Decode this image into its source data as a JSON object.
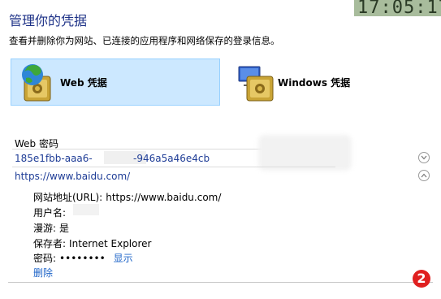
{
  "clock_fragment": "17:05:17",
  "title": "管理你的凭据",
  "subtitle": "查看并删除你为网站、已连接的应用程序和网络保存的登录信息。",
  "tiles": {
    "web_label": "Web 凭据",
    "windows_label": "Windows 凭据"
  },
  "section_label": "Web 密码",
  "entries": [
    {
      "prefix": "185e1fbb-aaa6-",
      "suffix": "-946a5a46e4cb",
      "expanded": false
    },
    {
      "url": "https://www.baidu.com/",
      "expanded": true
    }
  ],
  "details": {
    "site_label": "网站地址(URL):",
    "site_value": "https://www.baidu.com/",
    "user_label": "用户名:",
    "roaming_label": "漫游:",
    "roaming_value": "是",
    "saved_by_label": "保存者:",
    "saved_by_value": "Internet Explorer",
    "password_label": "密码:",
    "password_mask": "••••••••",
    "show_link": "显示",
    "delete_link": "删除"
  },
  "badge": "2",
  "colors": {
    "title": "#1e3287",
    "link": "#1e64c8",
    "selected_tile": "#cce8ff",
    "badge": "#e02020"
  }
}
